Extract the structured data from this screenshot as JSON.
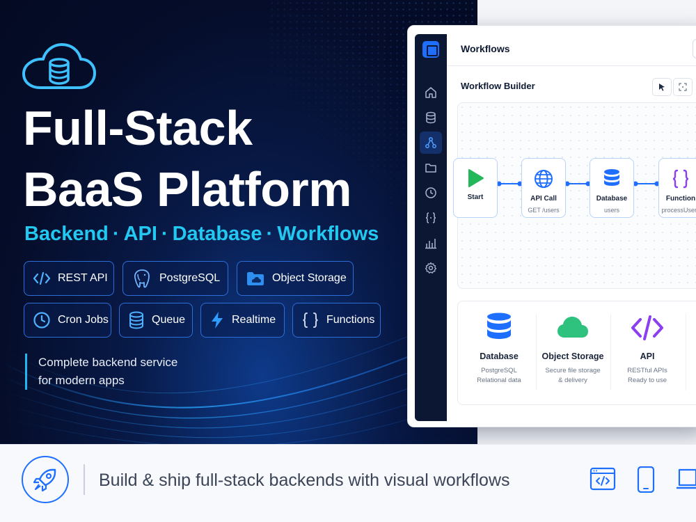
{
  "hero": {
    "title_line1": "Full-Stack",
    "title_line2": "BaaS Platform",
    "subtitle_parts": [
      "Backend",
      "API",
      "Database",
      "Workflows"
    ],
    "subtitle_separator": "·",
    "features": [
      {
        "label": "REST API",
        "icon": "code-icon"
      },
      {
        "label": "PostgreSQL",
        "icon": "postgresql-elephant-icon"
      },
      {
        "label": "Object Storage",
        "icon": "cloud-folder-icon"
      },
      {
        "label": "Cron Jobs",
        "icon": "clock-icon"
      },
      {
        "label": "Queue",
        "icon": "database-stack-icon"
      },
      {
        "label": "Realtime",
        "icon": "lightning-icon"
      },
      {
        "label": "Functions",
        "icon": "curly-braces-icon"
      }
    ],
    "tagline_line1": "Complete backend service",
    "tagline_line2": "for modern apps"
  },
  "app": {
    "header_title": "Workflows",
    "builder_title": "Workflow Builder",
    "sidebar_icons": [
      "home-icon",
      "database-icon",
      "workflow-icon",
      "folder-icon",
      "clock-icon",
      "function-icon",
      "chart-icon",
      "settings-icon"
    ],
    "active_sidebar_item": "workflow-icon",
    "nodes": [
      {
        "label": "Start",
        "sub": "",
        "icon": "play-icon"
      },
      {
        "label": "API Call",
        "sub": "GET /users",
        "icon": "globe-icon"
      },
      {
        "label": "Database",
        "sub": "users",
        "icon": "database-icon"
      },
      {
        "label": "Function",
        "sub": "processUsers",
        "icon": "curly-braces-icon"
      }
    ],
    "service_cards": [
      {
        "title": "Database",
        "desc_line1": "PostgreSQL",
        "desc_line2": "Relational data",
        "icon": "database-icon"
      },
      {
        "title": "Object Storage",
        "desc_line1": "Secure file storage",
        "desc_line2": "& delivery",
        "icon": "cloud-icon"
      },
      {
        "title": "API",
        "desc_line1": "RESTful APIs",
        "desc_line2": "Ready to use",
        "icon": "code-icon"
      }
    ]
  },
  "bottom": {
    "text": "Build & ship full-stack backends with visual workflows",
    "icons": [
      "rocket-icon",
      "browser-code-icon",
      "mobile-icon",
      "laptop-icon"
    ]
  },
  "colors": {
    "accent_blue": "#1f6fff",
    "accent_cyan": "#22c8f0",
    "hero_dark": "#050d2a",
    "start_green": "#22b85a",
    "storage_green": "#2ec27e",
    "function_purple": "#8b3ff0"
  }
}
